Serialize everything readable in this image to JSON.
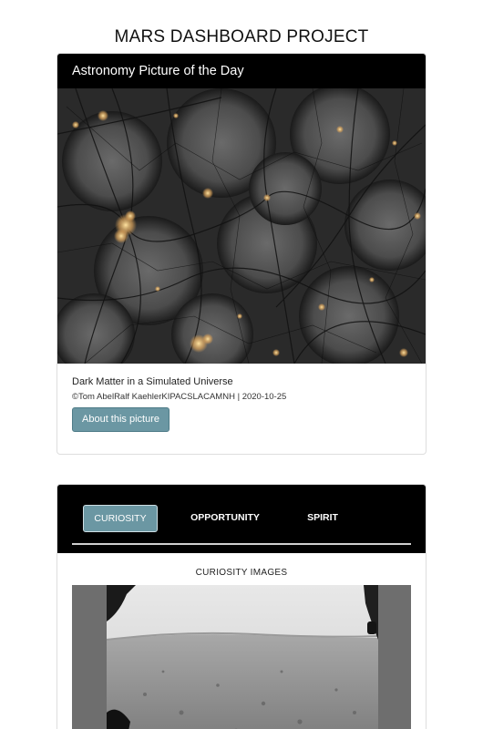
{
  "page": {
    "title": "MARS DASHBOARD PROJECT"
  },
  "apod": {
    "header": "Astronomy Picture of the Day",
    "image_title": "Dark Matter in a Simulated Universe",
    "credit": "©Tom AbelRalf KaehlerKIPACSLACAMNH | 2020-10-25",
    "button_label": "About this picture"
  },
  "rovers": {
    "tabs": [
      {
        "label": "CURIOSITY",
        "active": true
      },
      {
        "label": "OPPORTUNITY",
        "active": false
      },
      {
        "label": "SPIRIT",
        "active": false
      }
    ],
    "images_title": "CURIOSITY IMAGES"
  },
  "colors": {
    "accent": "#6b97a3",
    "header_bg": "#000000"
  }
}
